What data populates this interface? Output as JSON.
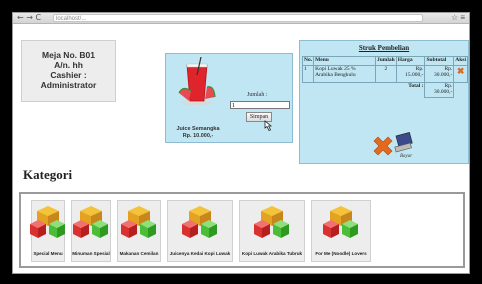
{
  "browser": {
    "nav": "← → C",
    "url": "localhost/...",
    "menu": "☆ ≡"
  },
  "table_info": {
    "table_no": "Meja No. B01",
    "name": "A/n. hh",
    "cashier": "Cashier : Administrator"
  },
  "order": {
    "product_name": "Juice Semangka",
    "product_price": "Rp. 10.000,-",
    "qty_label": "Jumlah :",
    "qty_value": "1",
    "save_label": "Simpan"
  },
  "receipt": {
    "title": "Struk Pembelian",
    "columns": [
      "No.",
      "Menu",
      "Jumlah",
      "Harga",
      "Subtotal",
      "Aksi"
    ],
    "rows": [
      {
        "no": "1",
        "menu": "Kopi Luwak 25 % Arabika Bengkulu",
        "qty": "2",
        "price": "Rp. 15.000,-",
        "subtotal": "Rp. 30.000,-",
        "action_icon": "delete-icon"
      }
    ],
    "total_label": "Total :",
    "total_value": "Rp. 30.000,-",
    "pay_label": "Bayar"
  },
  "category_title": "Kategori",
  "categories": [
    {
      "label": "Special Menu",
      "icon": "boxes-icon"
    },
    {
      "label": "Minuman Spesial",
      "icon": "boxes-icon"
    },
    {
      "label": "Makanan Cemilan",
      "icon": "boxes-icon"
    },
    {
      "label": "Juicenya Kedai Kopi Luwak",
      "icon": "boxes-icon"
    },
    {
      "label": "Kopi Luwak Arabika Tubruk",
      "icon": "boxes-icon"
    },
    {
      "label": "For Me (Noodle) Lovers",
      "icon": "boxes-icon"
    }
  ],
  "colors": {
    "panel_blue": "#bfe6f2",
    "delete_orange": "#e2691d"
  }
}
